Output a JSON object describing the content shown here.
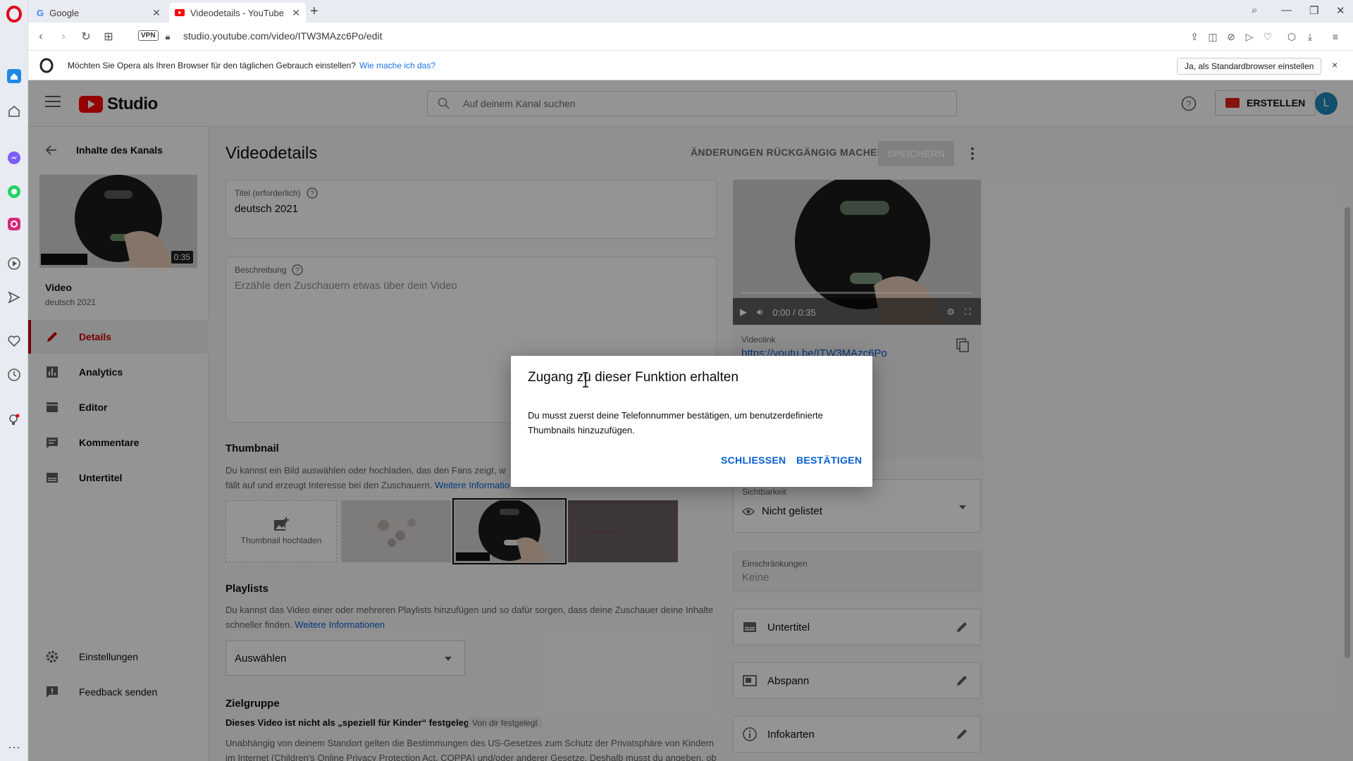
{
  "browser": {
    "tabs": [
      {
        "label": "Google",
        "active": false
      },
      {
        "label": "Videodetails - YouTube Studio",
        "active": true
      }
    ],
    "url": "studio.youtube.com/video/ITW3MAzc6Po/edit",
    "vpn_label": "VPN",
    "infobar": {
      "message": "Möchten Sie Opera als Ihren Browser für den täglichen Gebrauch einstellen?",
      "link": "Wie mache ich das?",
      "button": "Ja, als Standardbrowser einstellen",
      "close": "×"
    }
  },
  "studio": {
    "logo_text": "Studio",
    "search_placeholder": "Auf deinem Kanal suchen",
    "create_label": "ERSTELLEN",
    "avatar_letter": "L"
  },
  "sidebar": {
    "back_label": "Inhalte des Kanals",
    "thumb_duration": "0:35",
    "video_label": "Video",
    "video_title": "deutsch 2021",
    "items": [
      {
        "label": "Details",
        "icon": "pencil-icon",
        "active": true
      },
      {
        "label": "Analytics",
        "icon": "bar-chart-icon",
        "active": false
      },
      {
        "label": "Editor",
        "icon": "film-icon",
        "active": false
      },
      {
        "label": "Kommentare",
        "icon": "comment-icon",
        "active": false
      },
      {
        "label": "Untertitel",
        "icon": "subtitles-icon",
        "active": false
      }
    ],
    "bottom_items": [
      {
        "label": "Einstellungen",
        "icon": "gear-icon"
      },
      {
        "label": "Feedback senden",
        "icon": "feedback-icon"
      }
    ]
  },
  "main": {
    "title": "Videodetails",
    "undo_label": "ÄNDERUNGEN RÜCKGÄNGIG MACHEN",
    "save_label": "SPEICHERN",
    "title_field": {
      "label": "Titel (erforderlich)",
      "value": "deutsch 2021"
    },
    "description_field": {
      "label": "Beschreibung",
      "placeholder": "Erzähle den Zuschauern etwas über dein Video"
    },
    "thumbnail": {
      "heading": "Thumbnail",
      "text_1": "Du kannst ein Bild auswählen oder hochladen, das den Fans zeigt, w",
      "text_2": "fällt auf und erzeugt Interesse bei den Zuschauern.",
      "link": "Weitere Informatio",
      "upload_label": "Thumbnail hochladen"
    },
    "playlists": {
      "heading": "Playlists",
      "text_1": "Du kannst das Video einer oder mehreren Playlists hinzufügen und so dafür sorgen, dass deine Zuschauer deine Inhalte",
      "text_2": "schneller finden.",
      "link": "Weitere Informationen",
      "select_value": "Auswählen"
    },
    "audience": {
      "heading": "Zielgruppe",
      "status": "Dieses Video ist nicht als „speziell für Kinder“ festgelegt",
      "badge": "Von dir festgelegt",
      "text_1": "Unabhängig von deinem Standort gelten die Bestimmungen des US-Gesetzes zum Schutz der Privatsphäre von Kindern",
      "text_2": "im Internet (Children's Online Privacy Protection Act, COPPA) und/oder anderer Gesetze. Deshalb musst du angeben, ob"
    }
  },
  "right": {
    "player_time": "0:00 / 0:35",
    "videolink_label": "Videolink",
    "videolink_value": "https://youtu.be/ITW3MAzc6Po",
    "visibility": {
      "label": "Sichtbarkeit",
      "value": "Nicht gelistet"
    },
    "restrictions": {
      "label": "Einschränkungen",
      "value": "Keine"
    },
    "features": [
      {
        "label": "Untertitel",
        "icon": "subtitles-icon"
      },
      {
        "label": "Abspann",
        "icon": "end-screen-icon"
      },
      {
        "label": "Infokarten",
        "icon": "info-icon"
      }
    ]
  },
  "dialog": {
    "title": "Zugang zu dieser Funktion erhalten",
    "text": "Du musst zuerst deine Telefonnummer bestätigen, um benutzerdefinierte Thumbnails hinzuzufügen.",
    "close_label": "SCHLIESSEN",
    "confirm_label": "BESTÄTIGEN"
  },
  "colors": {
    "accent_red": "#cc0000",
    "link_blue": "#065fd4",
    "yt_red": "#ff0000"
  }
}
